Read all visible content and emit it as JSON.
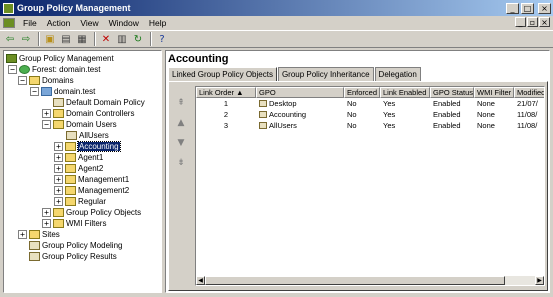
{
  "window": {
    "title": "Group Policy Management"
  },
  "menu": {
    "items": [
      "File",
      "Action",
      "View",
      "Window",
      "Help"
    ]
  },
  "toolbar": {
    "icons": [
      "back-icon",
      "forward-icon",
      "up-icon",
      "show-hide-tree-icon",
      "properties-icon",
      "delete-icon",
      "properties-sheet-icon",
      "refresh-icon",
      "help-icon"
    ]
  },
  "tree": {
    "items": [
      {
        "label": "Group Policy Management",
        "icon": "gpm-icon",
        "expander": ""
      },
      {
        "label": "Forest: domain.test",
        "icon": "forest-icon",
        "expander": "−"
      },
      {
        "label": "Domains",
        "icon": "folder-icon",
        "expander": "−"
      },
      {
        "label": "domain.test",
        "icon": "domain-icon",
        "expander": "−"
      },
      {
        "label": "Default Domain Policy",
        "icon": "gpo-link-icon",
        "expander": ""
      },
      {
        "label": "Domain Controllers",
        "icon": "ou-icon",
        "expander": "+"
      },
      {
        "label": "Domain Users",
        "icon": "ou-icon",
        "expander": "−"
      },
      {
        "label": "AllUsers",
        "icon": "gpo-link-icon",
        "expander": ""
      },
      {
        "label": "Accounting",
        "icon": "ou-icon",
        "expander": "+"
      },
      {
        "label": "Agent1",
        "icon": "ou-icon",
        "expander": "+"
      },
      {
        "label": "Agent2",
        "icon": "ou-icon",
        "expander": "+"
      },
      {
        "label": "Management1",
        "icon": "ou-icon",
        "expander": "+"
      },
      {
        "label": "Management2",
        "icon": "ou-icon",
        "expander": "+"
      },
      {
        "label": "Regular",
        "icon": "ou-icon",
        "expander": "+"
      },
      {
        "label": "Group Policy Objects",
        "icon": "folder-icon",
        "expander": "+"
      },
      {
        "label": "WMI Filters",
        "icon": "folder-icon",
        "expander": "+"
      },
      {
        "label": "Sites",
        "icon": "folder-icon",
        "expander": "+"
      },
      {
        "label": "Group Policy Modeling",
        "icon": "modeling-icon",
        "expander": ""
      },
      {
        "label": "Group Policy Results",
        "icon": "results-icon",
        "expander": ""
      }
    ]
  },
  "main": {
    "title": "Accounting",
    "tabs": [
      "Linked Group Policy Objects",
      "Group Policy Inheritance",
      "Delegation"
    ],
    "columns": [
      "Link Order",
      "GPO",
      "Enforced",
      "Link Enabled",
      "GPO Status",
      "WMI Filter",
      "Modified"
    ],
    "rows": [
      [
        "1",
        "Desktop",
        "No",
        "Yes",
        "Enabled",
        "None",
        "21/07/"
      ],
      [
        "2",
        "Accounting",
        "No",
        "Yes",
        "Enabled",
        "None",
        "11/08/"
      ],
      [
        "3",
        "AllUsers",
        "No",
        "Yes",
        "Enabled",
        "None",
        "11/08/"
      ]
    ]
  }
}
